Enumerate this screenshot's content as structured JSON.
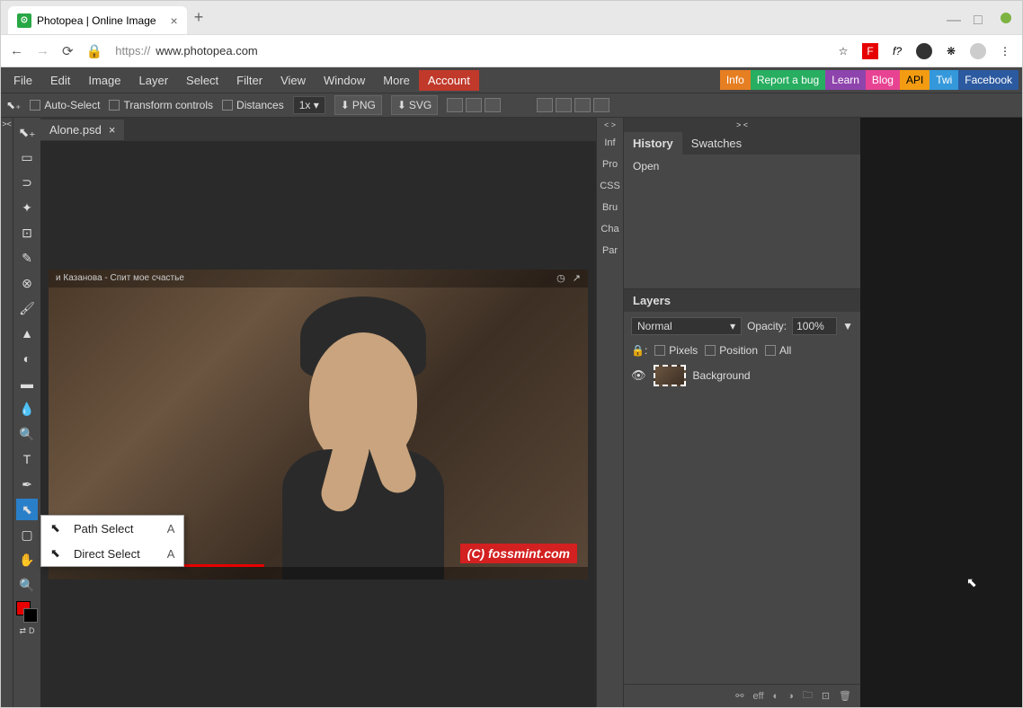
{
  "browser": {
    "tab_title": "Photopea | Online Image",
    "url_prefix": "https://",
    "url": "www.photopea.com"
  },
  "menu": [
    "File",
    "Edit",
    "Image",
    "Layer",
    "Select",
    "Filter",
    "View",
    "Window",
    "More",
    "Account"
  ],
  "badges": [
    {
      "label": "Info",
      "bg": "#e67e22"
    },
    {
      "label": "Report a bug",
      "bg": "#27ae60"
    },
    {
      "label": "Learn",
      "bg": "#8e44ad"
    },
    {
      "label": "Blog",
      "bg": "#e84393"
    },
    {
      "label": "API",
      "bg": "#f39c12"
    },
    {
      "label": "Twi",
      "bg": "#3498db"
    },
    {
      "label": "Facebook",
      "bg": "#2c5aa0"
    }
  ],
  "options": {
    "auto_select": "Auto-Select",
    "transform": "Transform controls",
    "distances": "Distances",
    "zoom": "1x",
    "png": "PNG",
    "svg": "SVG"
  },
  "doc_tab": "Alone.psd",
  "context": [
    {
      "label": "Path Select",
      "key": "A"
    },
    {
      "label": "Direct Select",
      "key": "A"
    }
  ],
  "midtabs": [
    "Inf",
    "Pro",
    "CSS",
    "Bru",
    "Cha",
    "Par"
  ],
  "history": {
    "tab_history": "History",
    "tab_swatches": "Swatches",
    "entry": "Open"
  },
  "layers": {
    "title": "Layers",
    "blend": "Normal",
    "opacity_label": "Opacity:",
    "opacity_val": "100%",
    "lock_pixels": "Pixels",
    "lock_position": "Position",
    "lock_all": "All",
    "layer_name": "Background",
    "foot_eff": "eff"
  },
  "watermark": "(C) fossmint.com",
  "video_title": "и Казанова - Спит мое счастье"
}
